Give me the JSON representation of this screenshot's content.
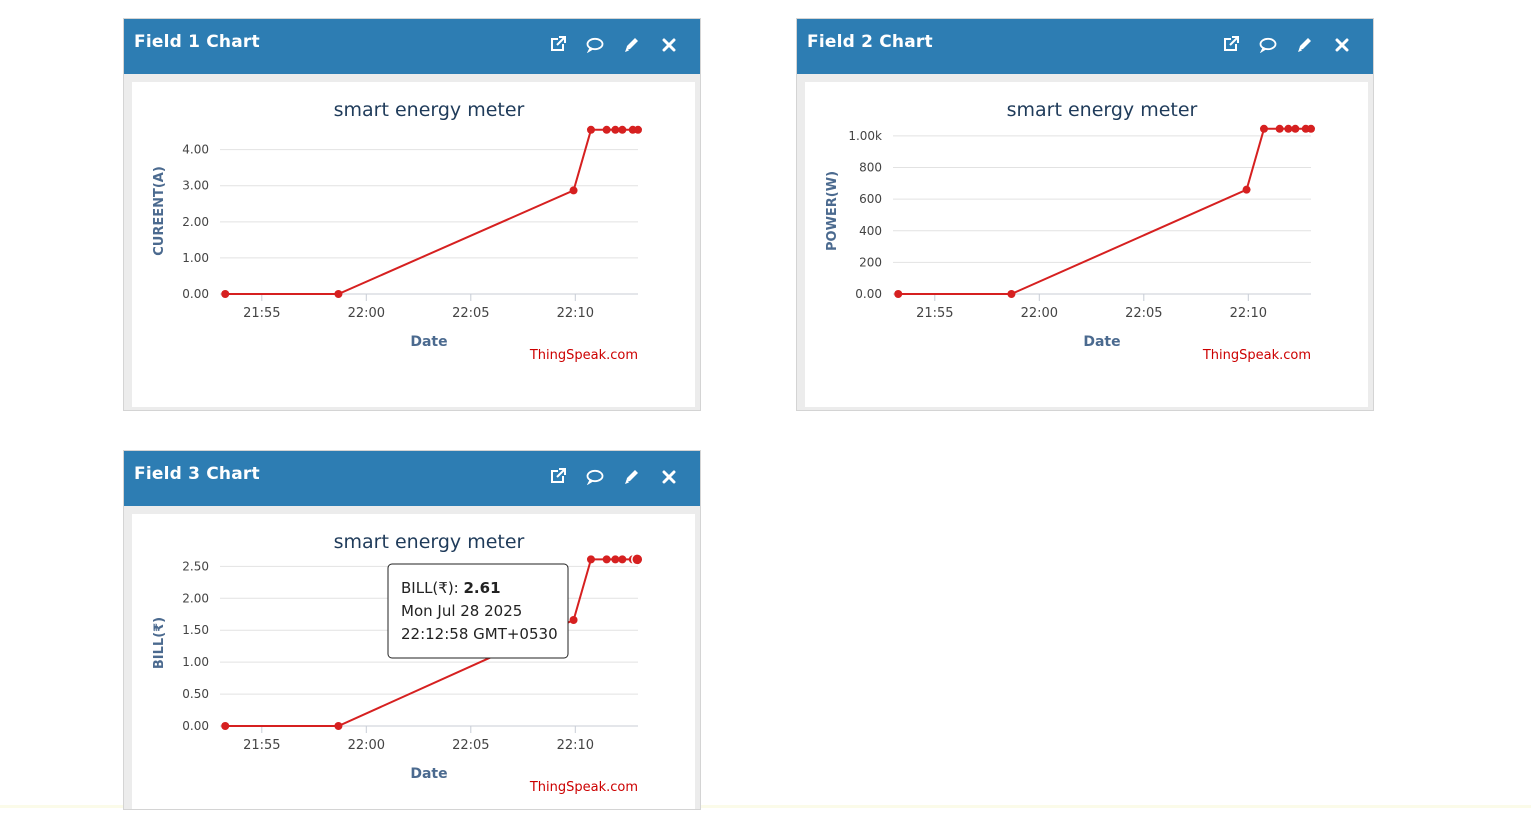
{
  "colors": {
    "header": "#2d7db3",
    "series": "#d62020",
    "axis_text": "#4b6a8f",
    "credit": "#cc0000"
  },
  "icons": [
    "external-link-icon",
    "comment-icon",
    "pencil-icon",
    "close-icon"
  ],
  "widgets": [
    {
      "title": "Field 1 Chart",
      "chart_title": "smart energy meter",
      "xlabel": "Date",
      "ylabel": "CUREENT(A)",
      "credit": "ThingSpeak.com",
      "yticks": [
        "0.00",
        "1.00",
        "2.00",
        "3.00",
        "4.00"
      ],
      "xticks": [
        "21:55",
        "22:00",
        "22:05",
        "22:10"
      ]
    },
    {
      "title": "Field 2 Chart",
      "chart_title": "smart energy meter",
      "xlabel": "Date",
      "ylabel": "POWER(W)",
      "credit": "ThingSpeak.com",
      "yticks": [
        "0.00",
        "200",
        "400",
        "600",
        "800",
        "1.00k"
      ],
      "xticks": [
        "21:55",
        "22:00",
        "22:05",
        "22:10"
      ]
    },
    {
      "title": "Field 3 Chart",
      "chart_title": "smart energy meter",
      "xlabel": "Date",
      "ylabel": "BILL(₹)",
      "credit": "ThingSpeak.com",
      "yticks": [
        "0.00",
        "0.50",
        "1.00",
        "1.50",
        "2.00",
        "2.50"
      ],
      "xticks": [
        "21:55",
        "22:00",
        "22:05",
        "22:10"
      ],
      "tooltip": {
        "series_label": "BILL(₹): ",
        "value": "2.61",
        "date": "Mon Jul 28 2025",
        "time": "22:12:58 GMT+0530"
      }
    }
  ],
  "chart_data": [
    {
      "type": "line",
      "title": "smart energy meter",
      "xlabel": "Date",
      "ylabel": "CUREENT(A)",
      "x": [
        "21:53:15",
        "21:58:40",
        "22:09:55",
        "22:10:45",
        "22:11:30",
        "22:11:55",
        "22:12:15",
        "22:12:45",
        "22:13:00"
      ],
      "series": [
        {
          "name": "CUREENT(A)",
          "values": [
            0,
            0,
            2.87,
            4.55,
            4.55,
            4.55,
            4.55,
            4.55,
            4.55
          ]
        }
      ],
      "ylim": [
        0,
        4.6
      ],
      "grid": true,
      "legend": "none"
    },
    {
      "type": "line",
      "title": "smart energy meter",
      "xlabel": "Date",
      "ylabel": "POWER(W)",
      "x": [
        "21:53:15",
        "21:58:40",
        "22:09:55",
        "22:10:45",
        "22:11:30",
        "22:11:55",
        "22:12:15",
        "22:12:45",
        "22:13:00"
      ],
      "series": [
        {
          "name": "POWER(W)",
          "values": [
            0,
            0,
            660,
            1045,
            1045,
            1045,
            1045,
            1045,
            1045
          ]
        }
      ],
      "ylim": [
        0,
        1050
      ],
      "grid": true,
      "legend": "none"
    },
    {
      "type": "line",
      "title": "smart energy meter",
      "xlabel": "Date",
      "ylabel": "BILL(₹)",
      "x": [
        "21:53:15",
        "21:58:40",
        "22:09:55",
        "22:10:45",
        "22:11:30",
        "22:11:55",
        "22:12:15",
        "22:12:45",
        "22:12:58"
      ],
      "series": [
        {
          "name": "BILL(₹)",
          "values": [
            0,
            0,
            1.66,
            2.61,
            2.61,
            2.61,
            2.61,
            2.61,
            2.61
          ]
        }
      ],
      "ylim": [
        0,
        2.6
      ],
      "grid": true,
      "legend": "none"
    }
  ]
}
